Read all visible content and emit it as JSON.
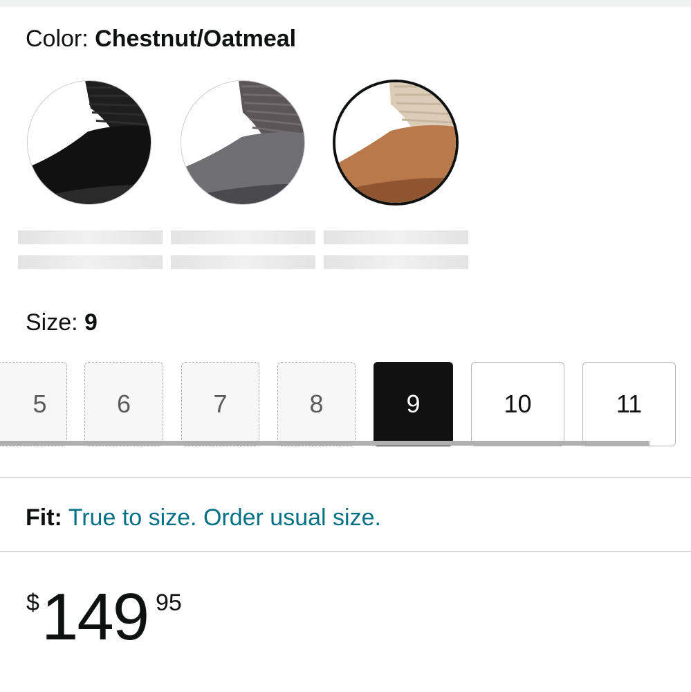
{
  "color": {
    "label": "Color: ",
    "selected": "Chestnut/Oatmeal",
    "swatches": [
      {
        "name": "black",
        "body": "#111111",
        "knit": "#1e1e1e",
        "selected": false
      },
      {
        "name": "gray",
        "body": "#6f6f73",
        "knit": "#5b5558",
        "selected": false
      },
      {
        "name": "chestnut-oatmeal",
        "body": "#b9794a",
        "knit": "#dccdb8",
        "selected": true
      }
    ]
  },
  "size": {
    "label": "Size: ",
    "selected": "9",
    "options": [
      {
        "label": "5",
        "state": "unavailable"
      },
      {
        "label": "6",
        "state": "unavailable"
      },
      {
        "label": "7",
        "state": "unavailable"
      },
      {
        "label": "8",
        "state": "unavailable"
      },
      {
        "label": "9",
        "state": "selected"
      },
      {
        "label": "10",
        "state": "available"
      },
      {
        "label": "11",
        "state": "available"
      }
    ]
  },
  "fit": {
    "label": "Fit:",
    "value": "True to size. Order usual size."
  },
  "price": {
    "symbol": "$",
    "whole": "149",
    "fraction": "95"
  },
  "colors": {
    "link": "#007185",
    "text": "#0f1111",
    "selected_bg": "#111111"
  }
}
